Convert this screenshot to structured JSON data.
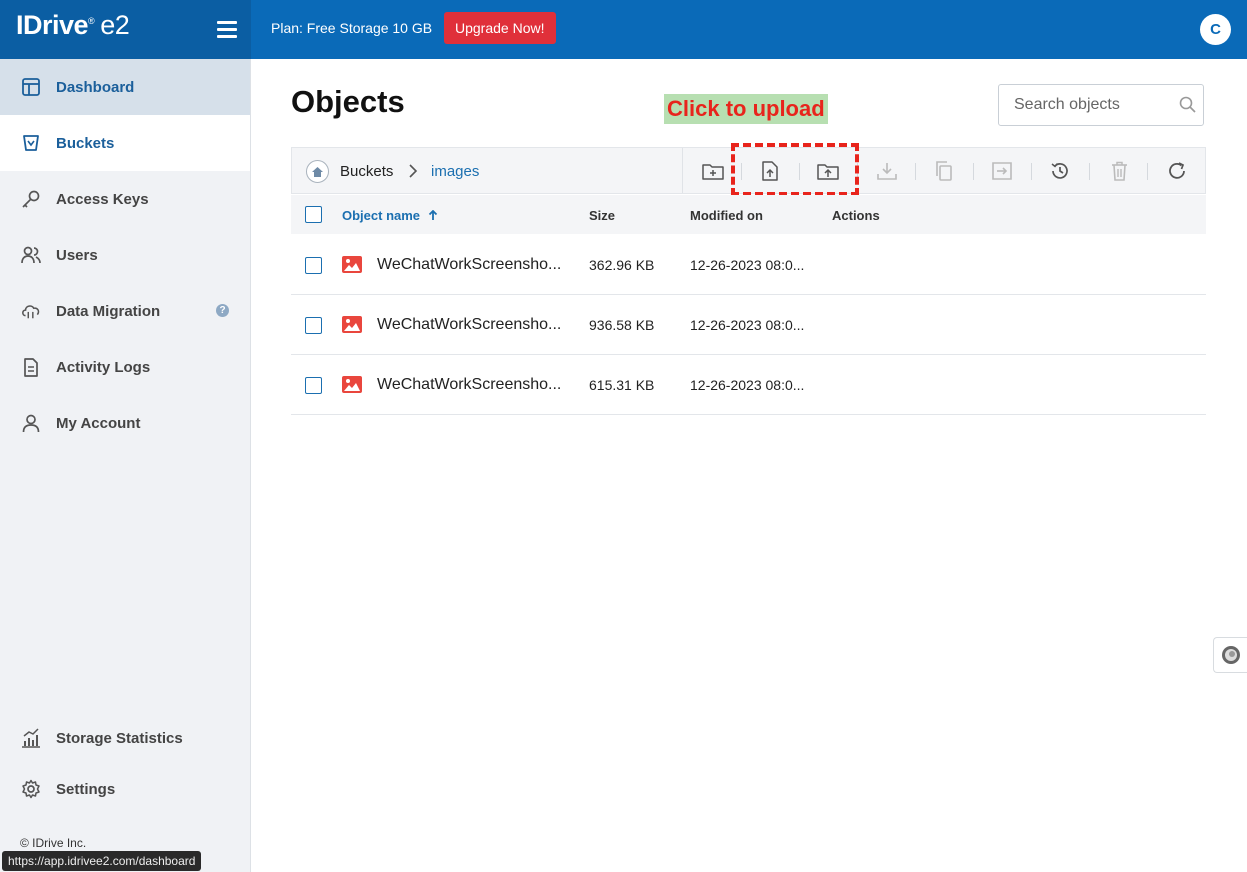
{
  "header": {
    "logo_text": "IDrive",
    "logo_reg": "®",
    "logo_suffix": "e2",
    "plan_text": "Plan: Free Storage 10 GB",
    "upgrade_label": "Upgrade Now!",
    "avatar_initial": "C",
    "brand_color": "#0a6ab8",
    "upgrade_color": "#e0303a"
  },
  "sidebar": {
    "items": [
      {
        "label": "Dashboard",
        "icon": "dashboard-icon"
      },
      {
        "label": "Buckets",
        "icon": "bucket-icon"
      },
      {
        "label": "Access Keys",
        "icon": "key-icon"
      },
      {
        "label": "Users",
        "icon": "users-icon"
      },
      {
        "label": "Data Migration",
        "icon": "cloud-migration-icon",
        "help": "?"
      },
      {
        "label": "Activity Logs",
        "icon": "document-icon"
      },
      {
        "label": "My Account",
        "icon": "user-icon"
      }
    ],
    "bottom_items": [
      {
        "label": "Storage Statistics",
        "icon": "statistics-icon"
      },
      {
        "label": "Settings",
        "icon": "gear-icon"
      }
    ],
    "copyright": "© IDrive Inc."
  },
  "status_bar": {
    "url": "https://app.idrivee2.com/dashboard"
  },
  "main": {
    "title": "Objects",
    "callout": "Click to upload",
    "search_placeholder": "Search objects",
    "breadcrumb": {
      "root": "Buckets",
      "current": "images"
    },
    "toolbar_icons": [
      "new-folder-icon",
      "upload-file-icon",
      "upload-folder-icon",
      "download-icon",
      "copy-icon",
      "move-icon",
      "version-history-icon",
      "delete-icon",
      "refresh-icon"
    ],
    "table": {
      "columns": [
        "Object name",
        "Size",
        "Modified on",
        "Actions"
      ],
      "rows": [
        {
          "name": "WeChatWorkScreensho...",
          "size": "362.96 KB",
          "modified": "12-26-2023 08:0..."
        },
        {
          "name": "WeChatWorkScreensho...",
          "size": "936.58 KB",
          "modified": "12-26-2023 08:0..."
        },
        {
          "name": "WeChatWorkScreensho...",
          "size": "615.31 KB",
          "modified": "12-26-2023 08:0..."
        }
      ]
    }
  }
}
